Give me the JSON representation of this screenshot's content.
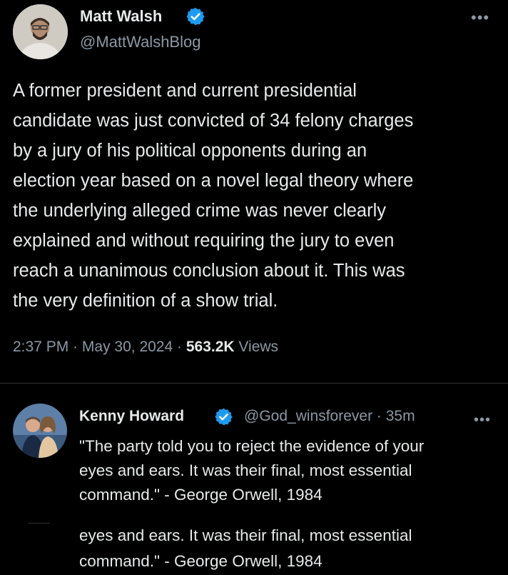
{
  "tweet": {
    "author_name": "Matt Walsh",
    "author_handle": "@MattWalshBlog",
    "verified_icon": "verified-badge-icon",
    "more_icon": "more-options-icon",
    "text_lines": [
      "A former president and current presidential",
      "candidate was just convicted of 34 felony charges",
      "by a jury of his political opponents during an",
      "election year based on a novel legal theory where",
      "the underlying alleged crime was never clearly",
      "explained and without requiring the jury to even",
      "reach a unanimous conclusion about it. This was",
      "the very definition of a show trial."
    ],
    "time": "2:37 PM",
    "sep1": "·",
    "date": "May 30, 2024",
    "sep2": "·",
    "views_count": "563.2K",
    "views_label": "Views"
  },
  "reply": {
    "author_name": "Kenny Howard",
    "author_handle": "@God_winsforever",
    "sep": "·",
    "age": "35m",
    "verified_icon": "verified-badge-icon",
    "more_icon": "more-options-icon",
    "text_lines": [
      "\"The party told you to reject the evidence of your",
      "eyes and ears. It was their final, most essential",
      "command.\" - George Orwell, 1984"
    ],
    "duplicate_lines": [
      "eyes and ears. It was their final, most essential",
      "command.\" - George Orwell, 1984"
    ]
  },
  "colors": {
    "background": "#000000",
    "text": "#e7e9ea",
    "secondary": "#8b98a5",
    "verified": "#1d9bf0",
    "divider": "#2f3336"
  }
}
